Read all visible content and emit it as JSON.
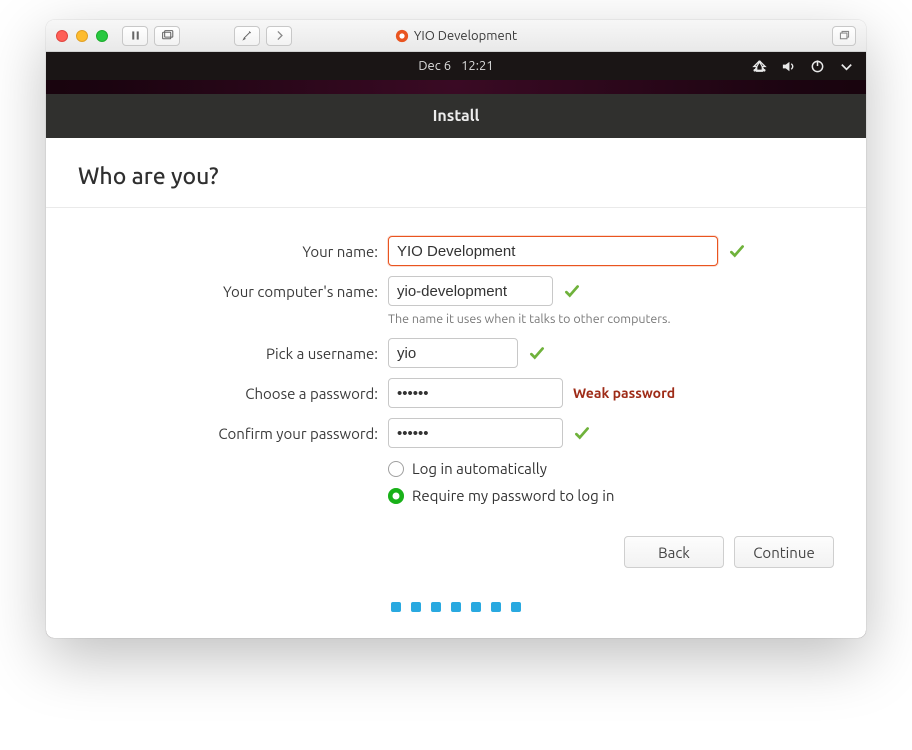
{
  "mac": {
    "title": "YIO Development"
  },
  "gnome": {
    "date": "Dec 6",
    "time": "12:21"
  },
  "installer": {
    "title": "Install",
    "heading": "Who are you?",
    "labels": {
      "name": "Your name:",
      "computer": "Your computer's name:",
      "username": "Pick a username:",
      "password": "Choose a password:",
      "confirm": "Confirm your password:"
    },
    "values": {
      "name": "YIO Development",
      "computer": "yio-development",
      "username": "yio",
      "password": "••••••",
      "confirm": "••••••"
    },
    "help": {
      "computer": "The name it uses when it talks to other computers."
    },
    "password_strength": "Weak password",
    "radios": {
      "auto": "Log in automatically",
      "require": "Require my password to log in"
    },
    "buttons": {
      "back": "Back",
      "continue": "Continue"
    }
  }
}
